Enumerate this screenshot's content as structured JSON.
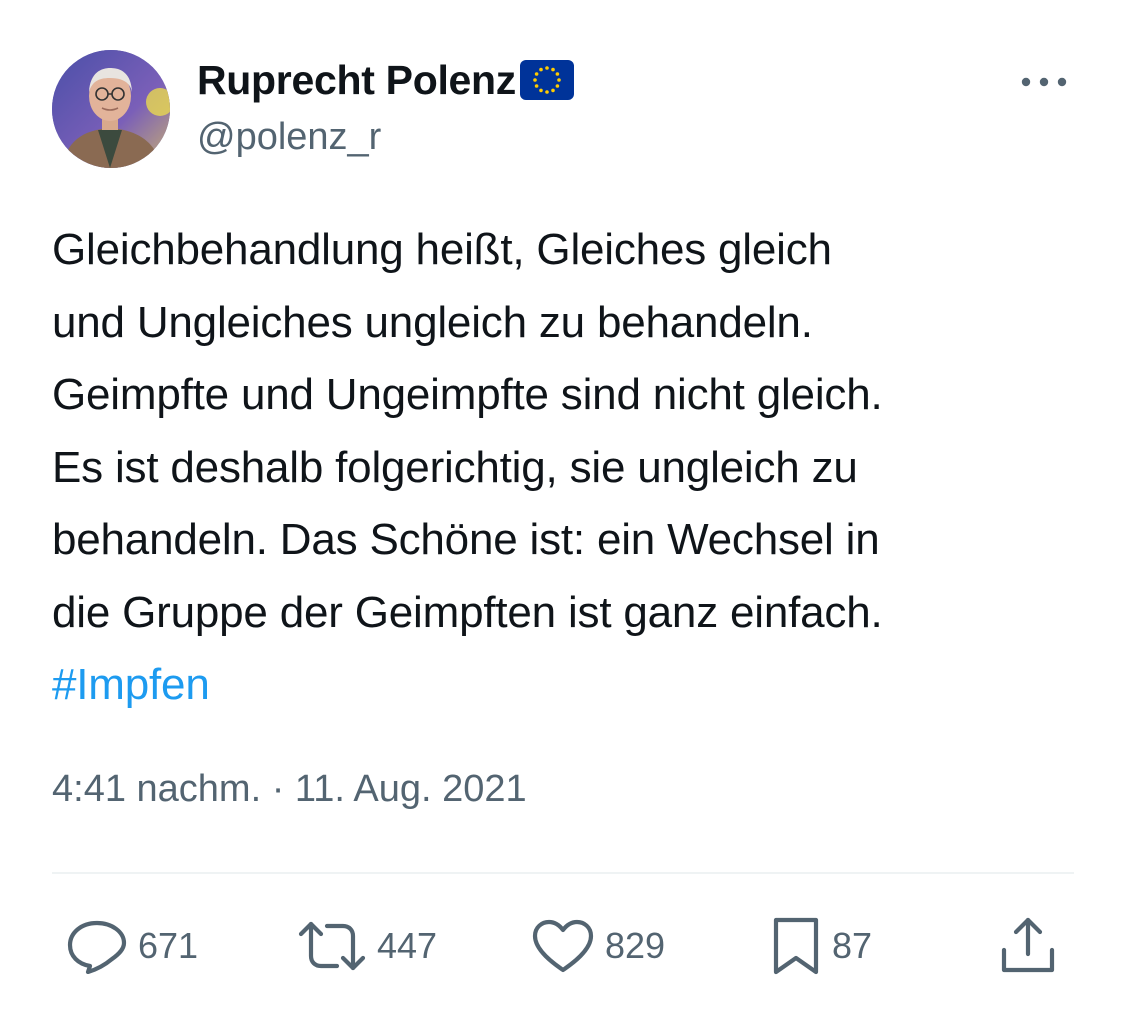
{
  "author": {
    "display_name": "Ruprecht Polenz",
    "handle": "@polenz_r",
    "badge_icon": "eu-flag-icon"
  },
  "tweet": {
    "lines": [
      "Gleichbehandlung heißt, Gleiches gleich",
      "und Ungleiches ungleich zu behandeln.",
      "Geimpfte und Ungeimpfte sind nicht gleich.",
      "Es ist deshalb folgerichtig, sie ungleich zu",
      "behandeln. Das Schöne ist: ein Wechsel in",
      "die Gruppe der Geimpften ist ganz einfach."
    ],
    "hashtag": "#Impfen",
    "timestamp": "4:41 nachm. · 11. Aug. 2021"
  },
  "actions": {
    "replies": {
      "icon": "reply-icon",
      "count": "671"
    },
    "retweets": {
      "icon": "retweet-icon",
      "count": "447"
    },
    "likes": {
      "icon": "heart-icon",
      "count": "829"
    },
    "bookmarks": {
      "icon": "bookmark-icon",
      "count": "87"
    },
    "share": {
      "icon": "share-icon"
    }
  },
  "colors": {
    "text": "#0f1419",
    "secondary": "#536471",
    "link": "#1d9bf0",
    "divider": "#eff3f4",
    "eu_blue": "#003399",
    "eu_gold": "#ffcc00"
  }
}
